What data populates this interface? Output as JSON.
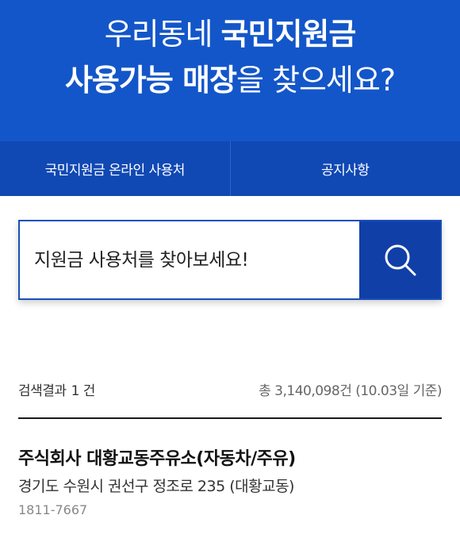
{
  "header": {
    "line1_normal": "우리동네 ",
    "line1_bold": "국민지원금",
    "line2_bold": "사용가능 매장",
    "line2_normal": "을 찾으세요?"
  },
  "tabs": [
    {
      "label": "국민지원금 온라인 사용처"
    },
    {
      "label": "공지사항"
    }
  ],
  "search": {
    "placeholder": "지원금 사용처를 찾아보세요!",
    "button_icon": "search-icon"
  },
  "results": {
    "count_label": "검색결과",
    "count_value": "1 건",
    "total_label": "총 3,140,098건 (10.03일 기준)",
    "items": [
      {
        "name": "주식회사 대황교동주유소(자동차/주유)",
        "address": "경기도 수원시 권선구 정조로 235 (대황교동)",
        "phone": "1811-7667"
      }
    ]
  },
  "colors": {
    "hero_bg": "#1356c9",
    "tab_bg": "#1049b4",
    "search_button_bg": "#103fa8"
  }
}
